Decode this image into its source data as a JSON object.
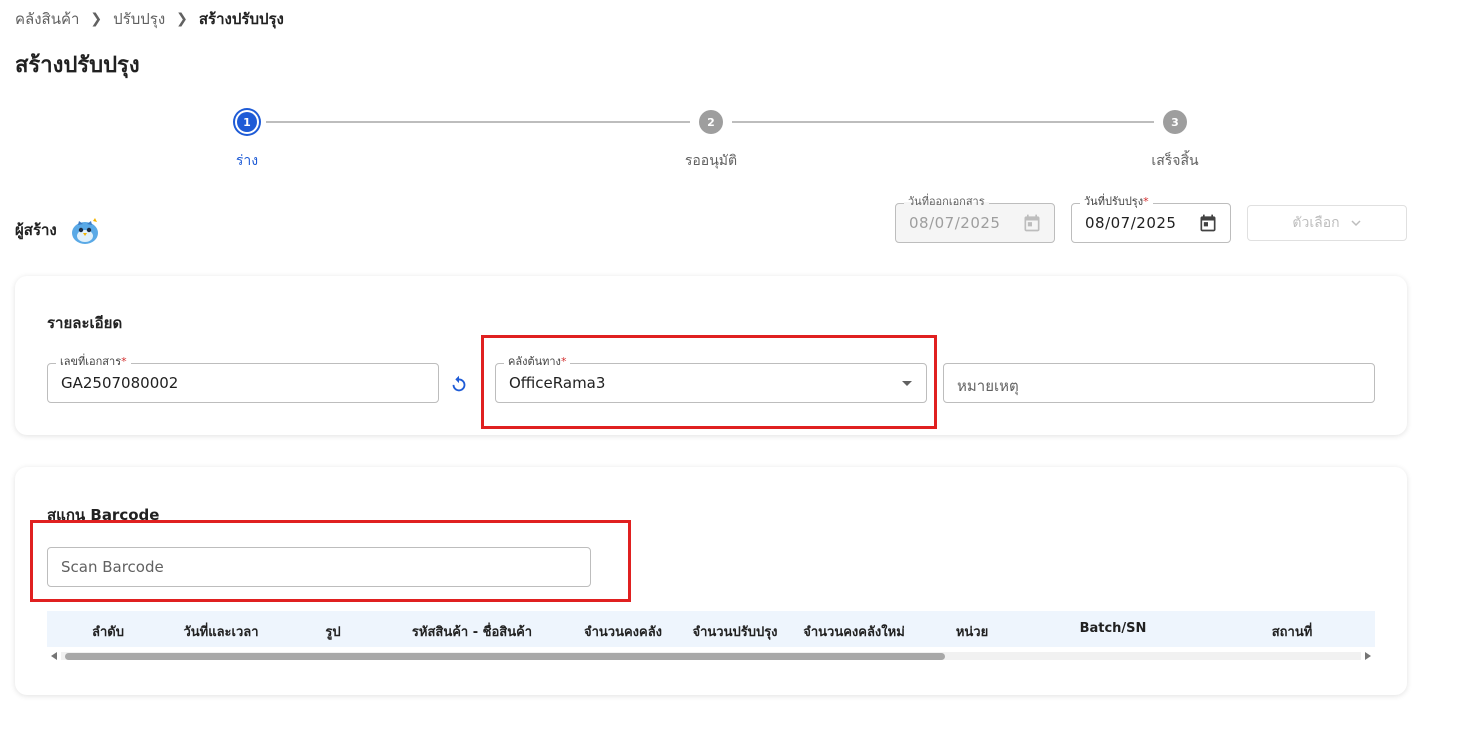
{
  "breadcrumb": {
    "items": [
      "คลังสินค้า",
      "ปรับปรุง",
      "สร้างปรับปรุง"
    ]
  },
  "page": {
    "title": "สร้างปรับปรุง"
  },
  "stepper": {
    "steps": [
      {
        "number": "1",
        "label": "ร่าง",
        "active": true
      },
      {
        "number": "2",
        "label": "รออนุมัติ",
        "active": false
      },
      {
        "number": "3",
        "label": "เสร็จสิ้น",
        "active": false
      }
    ]
  },
  "creator": {
    "label": "ผู้สร้าง",
    "avatar_icon": "bird-avatar-icon"
  },
  "dates": {
    "issue_date": {
      "label": "วันที่ออกเอกสาร",
      "value": "08/07/2025",
      "disabled": true
    },
    "adjust_date": {
      "label": "วันที่ปรับปรุง",
      "required": "*",
      "value": "08/07/2025"
    }
  },
  "options_button": {
    "label": "ตัวเลือก"
  },
  "details": {
    "title": "รายละเอียด",
    "doc_number": {
      "label": "เลขที่เอกสาร",
      "required": "*",
      "value": "GA2507080002"
    },
    "source_warehouse": {
      "label": "คลังต้นทาง",
      "required": "*",
      "value": "OfficeRama3"
    },
    "remark": {
      "placeholder": "หมายเหตุ"
    }
  },
  "scan": {
    "title": "สแกน Barcode",
    "input_placeholder": "Scan Barcode",
    "columns": [
      "ลำดับ",
      "วันที่และเวลา",
      "รูป",
      "รหัสสินค้า - ชื่อสินค้า",
      "จำนวนคงคลัง",
      "จำนวนปรับปรุง",
      "จำนวนคงคลังใหม่",
      "หน่วย",
      "Batch/SN",
      "สถานที่"
    ]
  },
  "colors": {
    "primary": "#1e5bd6",
    "highlight": "#e02020",
    "table_header_bg": "#eef5fd",
    "step_inactive": "#9e9e9e"
  }
}
